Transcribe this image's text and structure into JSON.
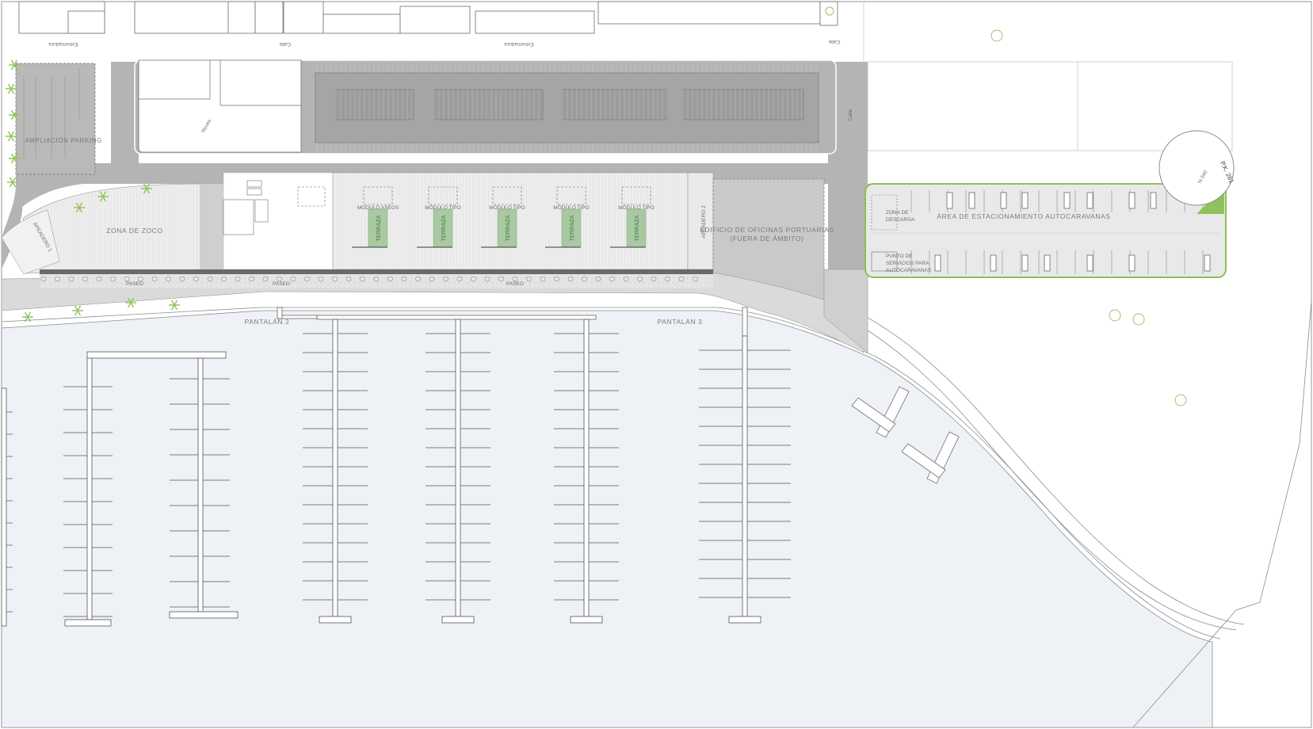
{
  "map": {
    "streets": {
      "extremadura_left": "Extremadura",
      "calle_1": "Calle",
      "extremadura_center": "Extremadura",
      "calle_2": "Calle",
      "noves": "Noves",
      "calle_vertical": "Calle"
    },
    "zones": {
      "ampliacion_parking": "AMPLIACIÓN PARKING",
      "zona_zoco": "ZONA DE ZOCO",
      "apeadero_1": "APEADERO 1",
      "apeadero_2": "APEADERO 2",
      "edificio_oficinas_line1": "EDIFICIO DE OFICINAS PORTUARIAS",
      "edificio_oficinas_line2": "(FUERA DE ÁMBITO)",
      "zona_descarga_line1": "ZONA DE",
      "zona_descarga_line2": "DESCARGA",
      "area_autocaravanas": "ÁREA DE ESTACIONAMIENTO AUTOCARAVANAS",
      "punto_servicios_line1": "PUNTO DE",
      "punto_servicios_line2": "SERVICIOS PARA",
      "punto_servicios_line3": "AUTOCARAVANAS"
    },
    "modules": [
      "MÓDULO ASEOS",
      "MÓDULO TIPO",
      "MÓDULO TIPO",
      "MÓDULO TIPO",
      "MÓDULO TIPO"
    ],
    "terraza": "TERRAZA",
    "paseo": [
      "PASEO",
      "PASEO",
      "PASEO"
    ],
    "pantalanes": {
      "p2": "PANTALÁN 2",
      "p3": "PANTALÁN 3"
    },
    "road_marker": {
      "road": "P.K. 261",
      "km": "N-340"
    },
    "colors": {
      "asphalt": "#b4b4b4",
      "parking_dark": "#a9a9a9",
      "plaza": "#ececec",
      "building_grey": "#c9c9c9",
      "water": "#eef2f7",
      "terraza_green": "#a8c9a2",
      "tree_green": "#8fc25a",
      "outline_green": "#8fbf55"
    }
  }
}
